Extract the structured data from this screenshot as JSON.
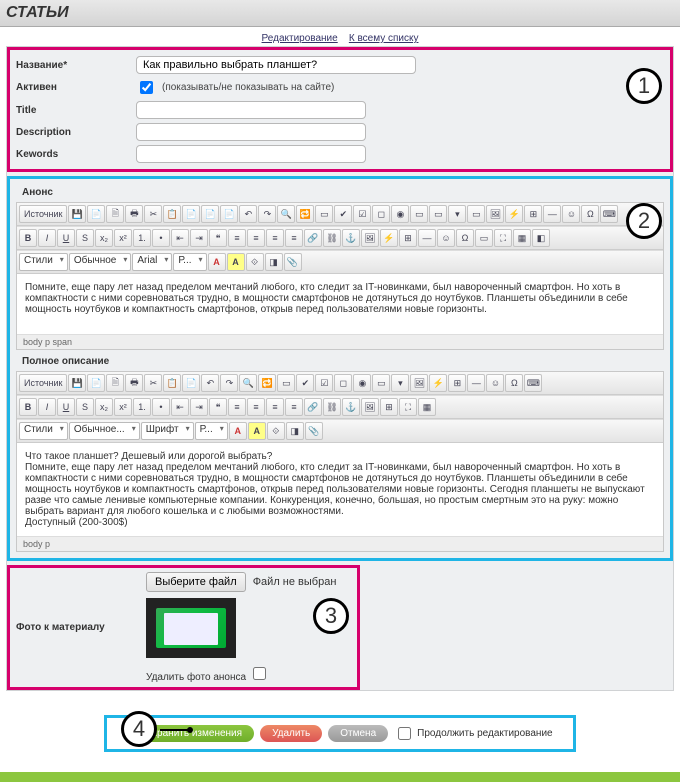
{
  "header": {
    "title": "СТАТЬИ"
  },
  "crumbs": {
    "edit": "Редактирование",
    "list": "К всему списку"
  },
  "markers": {
    "m1": "1",
    "m2": "2",
    "m3": "3",
    "m4": "4"
  },
  "fields": {
    "name_label": "Название*",
    "name_value": "Как правильно выбрать планшет?",
    "active_label": "Активен",
    "active_hint": "(показывать/не показывать на сайте)",
    "title_label": "Title",
    "description_label": "Description",
    "keywords_label": "Kewords"
  },
  "anons": {
    "label": "Анонс",
    "source_btn": "Источник",
    "styles_combo": "Стили",
    "format_combo": "Обычное",
    "font_combo": "Arial",
    "size_combo": "Р...",
    "body_text": "Помните, еще пару лет назад пределом мечтаний любого, кто следит за IT-новинками, был навороченный смартфон. Но хоть в компактности с ними соревноваться трудно, в мощности смартфонов не дотянуться до ноутбуков. Планшеты объединили в себе мощность ноутбуков и компактность смартфонов, открыв перед пользователями новые горизонты.",
    "path": "body p span"
  },
  "full": {
    "label": "Полное описание",
    "source_btn": "Источник",
    "styles_combo": "Стили",
    "format_combo": "Обычное...",
    "font_combo": "Шрифт",
    "size_combo": "Р...",
    "body_text": "Что такое планшет? Дешевый или дорогой выбрать?\nПомните, еще пару лет назад пределом мечтаний любого, кто следит за IT-новинками, был навороченный смартфон. Но хоть в компактности с ними соревноваться трудно, в мощности смартфонов не дотянуться до ноутбуков. Планшеты объединили в себе мощность ноутбуков и компактность смартфонов, открыв перед пользователями новые горизонты. Сегодня планшеты не выпускают разве что самые ленивые компьютерные компании. Конкуренция, конечно, большая, но простым смертным это на руку: можно выбрать вариант для любого кошелька и с любыми возможностями.\nДоступный (200-300$)",
    "path": "body p"
  },
  "photo": {
    "label": "Фото к материалу",
    "choose_btn": "Выберите файл",
    "no_file": "Файл не выбран",
    "delete_label": "Удалить фото анонса"
  },
  "actions": {
    "save": "Сохранить изменения",
    "delete": "Удалить",
    "cancel": "Отмена",
    "continue": "Продолжить редактирование"
  },
  "toolbar_icons": {
    "r1": [
      "💾",
      "📄",
      "🗎",
      "🖶",
      "",
      "✂",
      "📋",
      "📋",
      "📋",
      "📋",
      "📋",
      "",
      "↶",
      "↷",
      "",
      "🔍",
      "🔁",
      "🏷",
      "",
      "☑",
      "◻",
      "◉",
      "📝",
      "🔽",
      "🖼",
      "⚡",
      "⊞",
      "—",
      "☺",
      "Ω",
      "⌨",
      "↵"
    ],
    "r2": [
      "B",
      "I",
      "U",
      "S",
      "x₂",
      "x²",
      "",
      "≡",
      "≡",
      "≡",
      "",
      "•",
      "1.",
      "⇤",
      "⇥",
      "❝",
      "",
      "≡",
      "≡",
      "≡",
      "≡",
      "",
      "🔗",
      "⛓",
      "⚓",
      "",
      "🖼",
      "⚡",
      "⊞",
      "—",
      "☺",
      "Ω",
      "⌨",
      "↵",
      "",
      "⛶",
      "▦",
      "◧",
      "⟲"
    ],
    "r3": [
      "A",
      "A",
      "",
      "⟐",
      "◨",
      "📎"
    ]
  }
}
